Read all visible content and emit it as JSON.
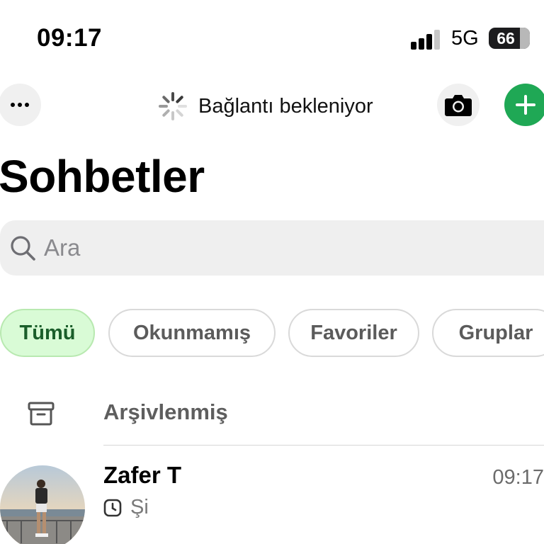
{
  "status_bar": {
    "time": "09:17",
    "network": "5G",
    "battery": "66",
    "battery_level_percent": 66
  },
  "top_bar": {
    "more_icon": "ellipsis-icon",
    "connection_text": "Bağlantı bekleniyor",
    "connection_icon": "spinner-icon",
    "camera_icon": "camera-icon",
    "new_chat_icon": "plus-icon",
    "accent_color": "#1fa855"
  },
  "page": {
    "title": "Sohbetler"
  },
  "search": {
    "placeholder": "Ara",
    "value": ""
  },
  "filters": [
    {
      "label": "Tümü",
      "active": true
    },
    {
      "label": "Okunmamış",
      "active": false
    },
    {
      "label": "Favoriler",
      "active": false
    },
    {
      "label": "Gruplar",
      "active": false
    }
  ],
  "archived": {
    "label": "Arşivlenmiş",
    "icon": "archive-icon"
  },
  "chats": [
    {
      "name": "Zafer T",
      "time": "09:17",
      "preview": "Şi",
      "status_icon": "clock-icon"
    }
  ]
}
